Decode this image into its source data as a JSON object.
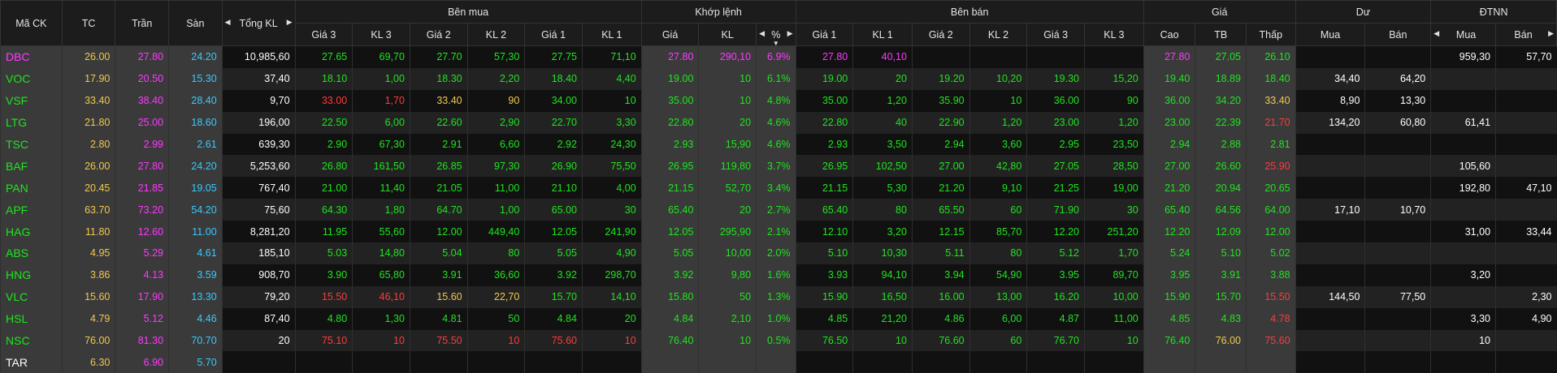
{
  "headers": {
    "ma_ck": "Mã CK",
    "tc": "TC",
    "tran": "Trần",
    "san": "Sàn",
    "tong_kl": "Tổng KL",
    "ben_mua": "Bên mua",
    "khop_lenh": "Khớp lệnh",
    "ben_ban": "Bên bán",
    "gia": "Giá",
    "du": "Dư",
    "dtnn": "ĐTNN",
    "sub": [
      "Giá 3",
      "KL 3",
      "Giá 2",
      "KL 2",
      "Giá 1",
      "KL 1",
      "Giá",
      "KL",
      "%",
      "Giá 1",
      "KL 1",
      "Giá 2",
      "KL 2",
      "Giá 3",
      "KL 3",
      "Cao",
      "TB",
      "Thấp",
      "Mua",
      "Bán",
      "Mua",
      "Bán"
    ]
  },
  "arrows": {
    "left": "◀",
    "right": "▶",
    "down": "▼"
  },
  "colors": {
    "green": "#1ee51e",
    "yellow": "#f2c94c",
    "red": "#ff3b3b",
    "purple": "#ff39ff",
    "cyan": "#39c9ff"
  },
  "rows": [
    [
      "DBC",
      "26.00",
      "27.80",
      "24.20",
      "10,985,60",
      "27.65",
      "69,70",
      "27.70",
      "57,30",
      "27.75",
      "71,10",
      "27.80",
      "290,10",
      "6.9%",
      "27.80",
      "40,10",
      "",
      "",
      "",
      "",
      "27.80",
      "27.05",
      "26.10",
      "",
      "",
      "959,30",
      "57,70"
    ],
    [
      "VOC",
      "17.90",
      "20.50",
      "15.30",
      "37,40",
      "18.10",
      "1,00",
      "18.30",
      "2,20",
      "18.40",
      "4,40",
      "19.00",
      "10",
      "6.1%",
      "19.00",
      "20",
      "19.20",
      "10,20",
      "19.30",
      "15,20",
      "19.40",
      "18.89",
      "18.40",
      "34,40",
      "64,20",
      "",
      ""
    ],
    [
      "VSF",
      "33.40",
      "38.40",
      "28.40",
      "9,70",
      "33.00",
      "1,70",
      "33.40",
      "90",
      "34.00",
      "10",
      "35.00",
      "10",
      "4.8%",
      "35.00",
      "1,20",
      "35.90",
      "10",
      "36.00",
      "90",
      "36.00",
      "34.20",
      "33.40",
      "8,90",
      "13,30",
      "",
      ""
    ],
    [
      "LTG",
      "21.80",
      "25.00",
      "18.60",
      "196,00",
      "22.50",
      "6,00",
      "22.60",
      "2,90",
      "22.70",
      "3,30",
      "22.80",
      "20",
      "4.6%",
      "22.80",
      "40",
      "22.90",
      "1,20",
      "23.00",
      "1,20",
      "23.00",
      "22.39",
      "21.70",
      "134,20",
      "60,80",
      "61,41",
      ""
    ],
    [
      "TSC",
      "2.80",
      "2.99",
      "2.61",
      "639,30",
      "2.90",
      "67,30",
      "2.91",
      "6,60",
      "2.92",
      "24,30",
      "2.93",
      "15,90",
      "4.6%",
      "2.93",
      "3,50",
      "2.94",
      "3,60",
      "2.95",
      "23,50",
      "2.94",
      "2.88",
      "2.81",
      "",
      "",
      "",
      ""
    ],
    [
      "BAF",
      "26.00",
      "27.80",
      "24.20",
      "5,253,60",
      "26.80",
      "161,50",
      "26.85",
      "97,30",
      "26.90",
      "75,50",
      "26.95",
      "119,80",
      "3.7%",
      "26.95",
      "102,50",
      "27.00",
      "42,80",
      "27.05",
      "28,50",
      "27.00",
      "26.60",
      "25.90",
      "",
      "",
      "105,60",
      ""
    ],
    [
      "PAN",
      "20.45",
      "21.85",
      "19.05",
      "767,40",
      "21.00",
      "11,40",
      "21.05",
      "11,00",
      "21.10",
      "4,00",
      "21.15",
      "52,70",
      "3.4%",
      "21.15",
      "5,30",
      "21.20",
      "9,10",
      "21.25",
      "19,00",
      "21.20",
      "20.94",
      "20.65",
      "",
      "",
      "192,80",
      "47,10"
    ],
    [
      "APF",
      "63.70",
      "73.20",
      "54.20",
      "75,60",
      "64.30",
      "1,80",
      "64.70",
      "1,00",
      "65.00",
      "30",
      "65.40",
      "20",
      "2.7%",
      "65.40",
      "80",
      "65.50",
      "60",
      "71.90",
      "30",
      "65.40",
      "64.56",
      "64.00",
      "17,10",
      "10,70",
      "",
      ""
    ],
    [
      "HAG",
      "11.80",
      "12.60",
      "11.00",
      "8,281,20",
      "11.95",
      "55,60",
      "12.00",
      "449,40",
      "12.05",
      "241,90",
      "12.05",
      "295,90",
      "2.1%",
      "12.10",
      "3,20",
      "12.15",
      "85,70",
      "12.20",
      "251,20",
      "12.20",
      "12.09",
      "12.00",
      "",
      "",
      "31,00",
      "33,44"
    ],
    [
      "ABS",
      "4.95",
      "5.29",
      "4.61",
      "185,10",
      "5.03",
      "14,80",
      "5.04",
      "80",
      "5.05",
      "4,90",
      "5.05",
      "10,00",
      "2.0%",
      "5.10",
      "10,30",
      "5.11",
      "80",
      "5.12",
      "1,70",
      "5.24",
      "5.10",
      "5.02",
      "",
      "",
      "",
      ""
    ],
    [
      "HNG",
      "3.86",
      "4.13",
      "3.59",
      "908,70",
      "3.90",
      "65,80",
      "3.91",
      "36,60",
      "3.92",
      "298,70",
      "3.92",
      "9,80",
      "1.6%",
      "3.93",
      "94,10",
      "3.94",
      "54,90",
      "3.95",
      "89,70",
      "3.95",
      "3.91",
      "3.88",
      "",
      "",
      "3,20",
      ""
    ],
    [
      "VLC",
      "15.60",
      "17.90",
      "13.30",
      "79,20",
      "15.50",
      "46,10",
      "15.60",
      "22,70",
      "15.70",
      "14,10",
      "15.80",
      "50",
      "1.3%",
      "15.90",
      "16,50",
      "16.00",
      "13,00",
      "16.20",
      "10,00",
      "15.90",
      "15.70",
      "15.50",
      "144,50",
      "77,50",
      "",
      "2,30"
    ],
    [
      "HSL",
      "4.79",
      "5.12",
      "4.46",
      "87,40",
      "4.80",
      "1,30",
      "4.81",
      "50",
      "4.84",
      "20",
      "4.84",
      "2,10",
      "1.0%",
      "4.85",
      "21,20",
      "4.86",
      "6,00",
      "4.87",
      "11,00",
      "4.85",
      "4.83",
      "4.78",
      "",
      "",
      "3,30",
      "4,90"
    ],
    [
      "NSC",
      "76.00",
      "81.30",
      "70.70",
      "20",
      "75.10",
      "10",
      "75.50",
      "10",
      "75.60",
      "10",
      "76.40",
      "10",
      "0.5%",
      "76.50",
      "10",
      "76.60",
      "60",
      "76.70",
      "10",
      "76.40",
      "76.00",
      "75.60",
      "",
      "",
      "10",
      ""
    ],
    [
      "TAR",
      "6.30",
      "6.90",
      "5.70",
      "",
      "",
      "",
      "",
      "",
      "",
      "",
      "",
      "",
      "",
      "",
      "",
      "",
      "",
      "",
      "",
      "",
      "",
      "",
      "",
      "",
      "",
      ""
    ]
  ],
  "row_colors": [
    [
      "purple",
      "yellow",
      "purple",
      "cyan",
      "white",
      "green",
      "green",
      "green",
      "green",
      "green",
      "green",
      "purple",
      "purple",
      "purple",
      "purple",
      "purple",
      "",
      "",
      "",
      "",
      "purple",
      "green",
      "green",
      "white",
      "white",
      "white",
      "white"
    ],
    [
      "green",
      "yellow",
      "purple",
      "cyan",
      "white",
      "green",
      "green",
      "green",
      "green",
      "green",
      "green",
      "green",
      "green",
      "green",
      "green",
      "green",
      "green",
      "green",
      "green",
      "green",
      "green",
      "green",
      "green",
      "white",
      "white",
      "white",
      "white"
    ],
    [
      "green",
      "yellow",
      "purple",
      "cyan",
      "white",
      "red",
      "red",
      "yellow",
      "yellow",
      "green",
      "green",
      "green",
      "green",
      "green",
      "green",
      "green",
      "green",
      "green",
      "green",
      "green",
      "green",
      "green",
      "yellow",
      "white",
      "white",
      "white",
      "white"
    ],
    [
      "green",
      "yellow",
      "purple",
      "cyan",
      "white",
      "green",
      "green",
      "green",
      "green",
      "green",
      "green",
      "green",
      "green",
      "green",
      "green",
      "green",
      "green",
      "green",
      "green",
      "green",
      "green",
      "green",
      "red",
      "white",
      "white",
      "white",
      "white"
    ],
    [
      "green",
      "yellow",
      "purple",
      "cyan",
      "white",
      "green",
      "green",
      "green",
      "green",
      "green",
      "green",
      "green",
      "green",
      "green",
      "green",
      "green",
      "green",
      "green",
      "green",
      "green",
      "green",
      "green",
      "green",
      "white",
      "white",
      "white",
      "white"
    ],
    [
      "green",
      "yellow",
      "purple",
      "cyan",
      "white",
      "green",
      "green",
      "green",
      "green",
      "green",
      "green",
      "green",
      "green",
      "green",
      "green",
      "green",
      "green",
      "green",
      "green",
      "green",
      "green",
      "green",
      "red",
      "white",
      "white",
      "white",
      "white"
    ],
    [
      "green",
      "yellow",
      "purple",
      "cyan",
      "white",
      "green",
      "green",
      "green",
      "green",
      "green",
      "green",
      "green",
      "green",
      "green",
      "green",
      "green",
      "green",
      "green",
      "green",
      "green",
      "green",
      "green",
      "green",
      "white",
      "white",
      "white",
      "white"
    ],
    [
      "green",
      "yellow",
      "purple",
      "cyan",
      "white",
      "green",
      "green",
      "green",
      "green",
      "green",
      "green",
      "green",
      "green",
      "green",
      "green",
      "green",
      "green",
      "green",
      "green",
      "green",
      "green",
      "green",
      "green",
      "white",
      "white",
      "white",
      "white"
    ],
    [
      "green",
      "yellow",
      "purple",
      "cyan",
      "white",
      "green",
      "green",
      "green",
      "green",
      "green",
      "green",
      "green",
      "green",
      "green",
      "green",
      "green",
      "green",
      "green",
      "green",
      "green",
      "green",
      "green",
      "green",
      "white",
      "white",
      "white",
      "white"
    ],
    [
      "green",
      "yellow",
      "purple",
      "cyan",
      "white",
      "green",
      "green",
      "green",
      "green",
      "green",
      "green",
      "green",
      "green",
      "green",
      "green",
      "green",
      "green",
      "green",
      "green",
      "green",
      "green",
      "green",
      "green",
      "white",
      "white",
      "white",
      "white"
    ],
    [
      "green",
      "yellow",
      "purple",
      "cyan",
      "white",
      "green",
      "green",
      "green",
      "green",
      "green",
      "green",
      "green",
      "green",
      "green",
      "green",
      "green",
      "green",
      "green",
      "green",
      "green",
      "green",
      "green",
      "green",
      "white",
      "white",
      "white",
      "white"
    ],
    [
      "green",
      "yellow",
      "purple",
      "cyan",
      "white",
      "red",
      "red",
      "yellow",
      "yellow",
      "green",
      "green",
      "green",
      "green",
      "green",
      "green",
      "green",
      "green",
      "green",
      "green",
      "green",
      "green",
      "green",
      "red",
      "white",
      "white",
      "white",
      "white"
    ],
    [
      "green",
      "yellow",
      "purple",
      "cyan",
      "white",
      "green",
      "green",
      "green",
      "green",
      "green",
      "green",
      "green",
      "green",
      "green",
      "green",
      "green",
      "green",
      "green",
      "green",
      "green",
      "green",
      "green",
      "red",
      "white",
      "white",
      "white",
      "white"
    ],
    [
      "green",
      "yellow",
      "purple",
      "cyan",
      "white",
      "red",
      "red",
      "red",
      "red",
      "red",
      "red",
      "green",
      "green",
      "green",
      "green",
      "green",
      "green",
      "green",
      "green",
      "green",
      "green",
      "yellow",
      "red",
      "white",
      "white",
      "white",
      "white"
    ],
    [
      "white",
      "yellow",
      "purple",
      "cyan",
      "white",
      "",
      "",
      "",
      "",
      "",
      "",
      "",
      "",
      "",
      "",
      "",
      "",
      "",
      "",
      "",
      "",
      "",
      "",
      "",
      "",
      "",
      ""
    ]
  ]
}
